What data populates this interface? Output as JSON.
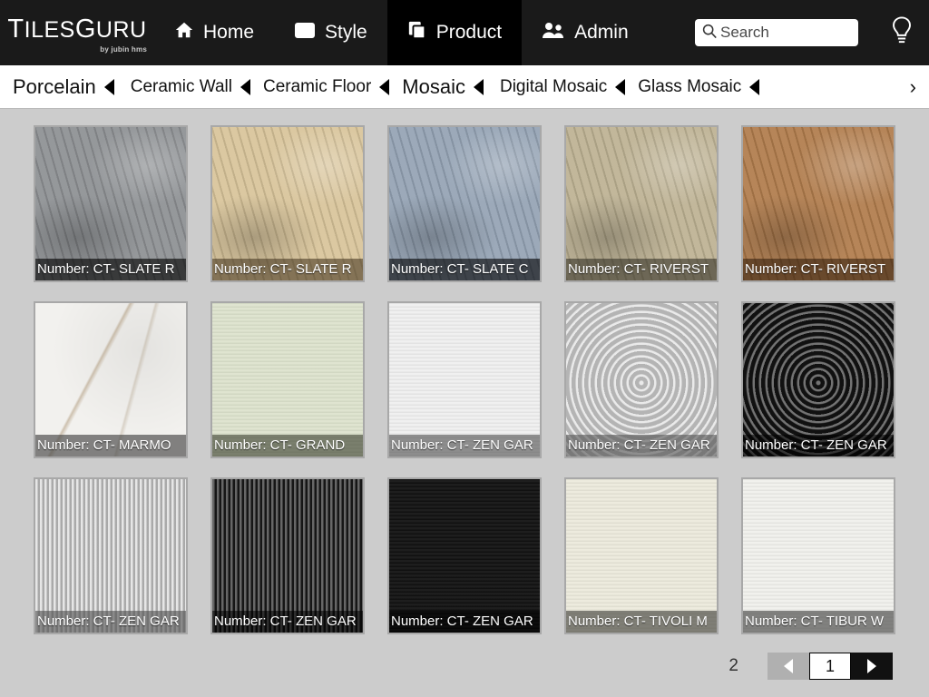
{
  "header": {
    "logo_main": "TILESGURU",
    "logo_sub": "by jubin hms",
    "nav": [
      {
        "label": "Home",
        "icon": "home-icon",
        "active": false
      },
      {
        "label": "Style",
        "icon": "style-icon",
        "active": false
      },
      {
        "label": "Product",
        "icon": "product-icon",
        "active": true
      },
      {
        "label": "Admin",
        "icon": "admin-icon",
        "active": false
      }
    ],
    "search_placeholder": "Search",
    "search_value": "",
    "bulb_icon": "lightbulb-icon",
    "bg_color": "#1a1a1a",
    "active_bg_color": "#000000"
  },
  "categories": [
    {
      "label": "Porcelain",
      "emphasized": true
    },
    {
      "label": "Ceramic Wall",
      "emphasized": false
    },
    {
      "label": "Ceramic Floor",
      "emphasized": false
    },
    {
      "label": "Mosaic",
      "emphasized": true
    },
    {
      "label": "Digital Mosaic",
      "emphasized": false
    },
    {
      "label": "Glass Mosaic",
      "emphasized": false
    }
  ],
  "category_next_icon": "chevron-right-icon",
  "products": [
    {
      "label": "Number: CT- SLATE R",
      "base": "#8d9093",
      "texture": "tx-stone",
      "label_bg": "rgba(0,0,0,0.62)"
    },
    {
      "label": "Number: CT- SLATE R",
      "base": "#d8c49a",
      "texture": "tx-stone",
      "label_bg": "rgba(60,45,25,0.55)"
    },
    {
      "label": "Number: CT- SLATE C",
      "base": "#94a3b4",
      "texture": "tx-stone",
      "label_bg": "rgba(0,0,0,0.60)"
    },
    {
      "label": "Number: CT- RIVERST",
      "base": "#bdb293",
      "texture": "tx-stone",
      "label_bg": "rgba(40,38,30,0.55)"
    },
    {
      "label": "Number: CT- RIVERST",
      "base": "#b07c4c",
      "texture": "tx-stone",
      "label_bg": "rgba(50,30,12,0.58)"
    },
    {
      "label": "Number: CT- MARMO",
      "base": "#f2f1ee",
      "texture": "tx-marble",
      "label_bg": "rgba(70,70,70,0.66)"
    },
    {
      "label": "Number: CT- GRAND",
      "base": "#dde3cd",
      "texture": "tx-wood",
      "label_bg": "rgba(60,64,48,0.62)"
    },
    {
      "label": "Number: CT- ZEN GAR",
      "base": "#efefef",
      "texture": "tx-wood",
      "label_bg": "rgba(80,80,80,0.62)"
    },
    {
      "label": "Number: CT- ZEN GAR",
      "base": "#dcdcdc",
      "texture": "tx-rings",
      "label_bg": "rgba(85,85,85,0.62)"
    },
    {
      "label": "Number: CT- ZEN GAR",
      "base": "#151515",
      "texture": "tx-rings",
      "label_bg": "rgba(0,0,0,0.55)"
    },
    {
      "label": "Number: CT- ZEN GAR",
      "base": "#d9d9d9",
      "texture": "tx-stripes",
      "label_bg": "rgba(80,80,80,0.62)"
    },
    {
      "label": "Number: CT- ZEN GAR",
      "base": "#1c1c1c",
      "texture": "tx-stripes",
      "label_bg": "rgba(0,0,0,0.55)"
    },
    {
      "label": "Number: CT- ZEN GAR",
      "base": "#121212",
      "texture": "tx-wood",
      "label_bg": "rgba(0,0,0,0.55)"
    },
    {
      "label": "Number: CT- TIVOLI M",
      "base": "#eceadc",
      "texture": "tx-wood",
      "label_bg": "rgba(70,70,64,0.66)"
    },
    {
      "label": "Number: CT- TIBUR W",
      "base": "#f0f0ec",
      "texture": "tx-wood",
      "label_bg": "rgba(72,72,70,0.66)"
    }
  ],
  "pagination": {
    "total_pages": "2",
    "current_page": "1",
    "prev_icon": "triangle-left-icon",
    "next_icon": "triangle-right-icon",
    "prev_disabled": true
  },
  "page_bg_color": "#cccccc"
}
